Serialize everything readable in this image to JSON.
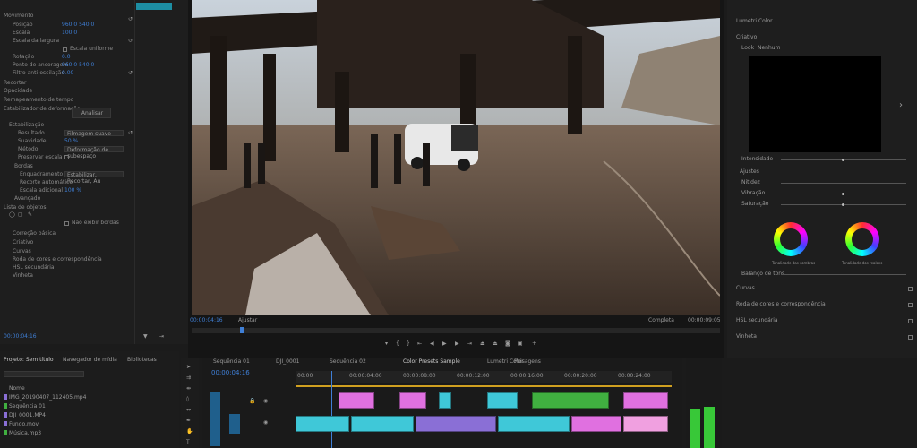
{
  "left_panel": {
    "tab_label": "",
    "rows": [
      {
        "label": "Movimento",
        "value": ""
      },
      {
        "label": "Posição",
        "value": "960.0   540.0"
      },
      {
        "label": "Escala",
        "value": "100.0"
      },
      {
        "label": "Escala da largura",
        "value": ""
      },
      {
        "label": "",
        "value": "Escala uniforme"
      },
      {
        "label": "Rotação",
        "value": "0.0"
      },
      {
        "label": "Ponto de ancoragem",
        "value": "960.0   540.0"
      },
      {
        "label": "Filtro anti-oscilação",
        "value": "0.00"
      },
      {
        "label": "Recortar",
        "value": ""
      },
      {
        "label": "Opacidade",
        "value": ""
      },
      {
        "label": "Remapeamento de tempo",
        "value": ""
      },
      {
        "label": "Estabilizador de deformação",
        "value": ""
      }
    ],
    "analyze_button": "Analisar",
    "rows2": [
      {
        "label": "Estabilização",
        "value": ""
      },
      {
        "label": "Resultado",
        "value": "Filmagem suave"
      },
      {
        "label": "Suavidade",
        "value": "50 %"
      },
      {
        "label": "Método",
        "value": "Deformação de subespaço"
      },
      {
        "label": "Preservar escala",
        "value": ""
      },
      {
        "label": "Bordas",
        "value": ""
      },
      {
        "label": "Enquadramento",
        "value": "Estabilizar, Recortar, Au"
      },
      {
        "label": "Recorte automático",
        "value": ""
      },
      {
        "label": "Escala adicional",
        "value": "100 %"
      },
      {
        "label": "Avançado",
        "value": ""
      },
      {
        "label": "Lista de objetos",
        "value": ""
      },
      {
        "label": "",
        "value": "Não exibir bordas"
      }
    ],
    "rows3": [
      "Correção básica",
      "Criativo",
      "Curvas",
      "Roda de cores e correspondência",
      "HSL secundária",
      "Vinheta"
    ],
    "timecode": "00:00:04:16"
  },
  "project_panel": {
    "tabs": [
      "Projeto: Sem título",
      "Navegador de mídia",
      "Bibliotecas"
    ],
    "items": [
      "Nome",
      "IMG_20190407_112405.mp4",
      "Sequência 01",
      "DJI_0001.MP4",
      "Fundo.mov",
      "Música.mp3"
    ]
  },
  "program_monitor": {
    "timecode_left": "00:00:04:16",
    "fit_label": "Ajustar",
    "quality": "Completa",
    "timecode_right": "00:00:09:05"
  },
  "timeline": {
    "timecode": "00:00:04:16",
    "sequence_tabs": [
      "Sequência 01",
      "DJI_0001",
      "Sequência 02",
      "Color Presets Sample",
      "Lumetri Color",
      "Paisagens"
    ],
    "ruler_labels": [
      "00:00",
      "00:00:04:00",
      "00:00:08:00",
      "00:00:12:00",
      "00:00:16:00",
      "00:00:20:00",
      "00:00:24:00"
    ]
  },
  "lumetri": {
    "title": "Lumetri Color",
    "section": "Criativo",
    "look_label": "Look",
    "look_value": "Nenhum",
    "intensity": "Intensidade",
    "adjustments": "Ajustes",
    "slider_labels": [
      "Nitidez",
      "Vibração",
      "Saturação"
    ],
    "wheel_labels": [
      "Tonalidade das sombras",
      "Tonalidade dos realces"
    ],
    "balance_label": "Balanço de tons",
    "sections_below": [
      "Curvas",
      "Roda de cores e correspondência",
      "HSL secundária",
      "Vinheta"
    ]
  },
  "colors": {
    "accent_blue": "#3f7fd6",
    "clip_cyan": "#3fc8d8",
    "clip_pink": "#e070e0",
    "clip_green": "#40b040",
    "meter_green": "#38c838"
  }
}
